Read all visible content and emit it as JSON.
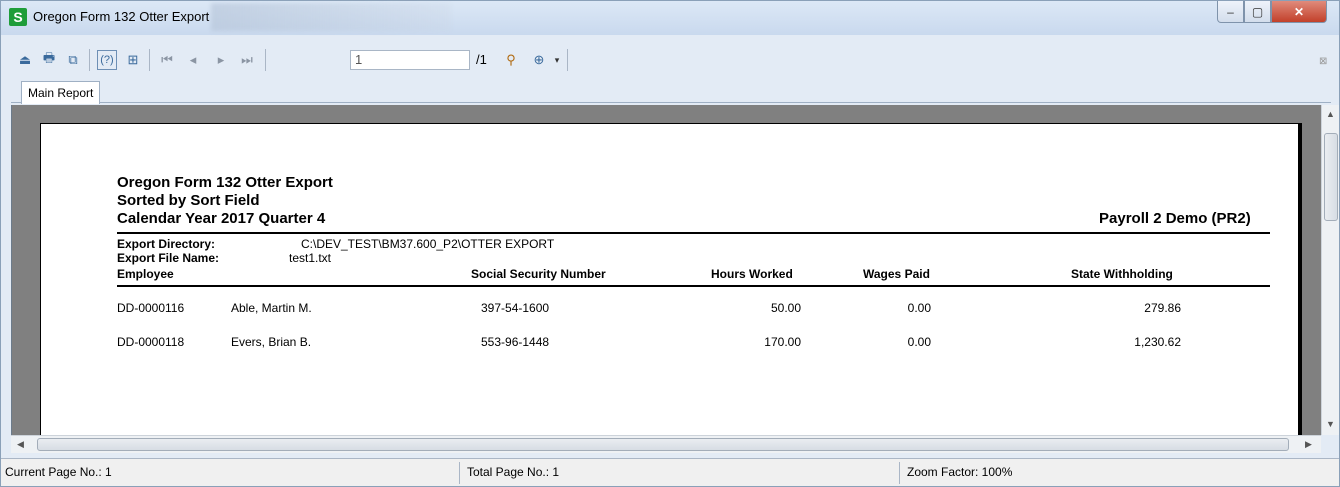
{
  "window": {
    "title": "Oregon Form 132 Otter Export",
    "icon_letter": "S",
    "minimize": "–",
    "maximize": "▢",
    "close": "✕"
  },
  "toolbar": {
    "page_input_value": "1",
    "page_total": "/1"
  },
  "tabs": [
    {
      "label": "Main Report"
    }
  ],
  "report": {
    "title_line1": "Oregon Form 132 Otter Export",
    "title_line2": "Sorted by Sort Field",
    "title_line3": "Calendar Year 2017 Quarter 4",
    "company": "Payroll 2 Demo (PR2)",
    "export_directory_label": "Export Directory:",
    "export_directory_value": "C:\\DEV_TEST\\BM37.600_P2\\OTTER EXPORT",
    "export_file_label": "Export File Name:",
    "export_file_value": "test1.txt",
    "columns": {
      "employee": "Employee",
      "ssn": "Social Security Number",
      "hours": "Hours Worked",
      "wages": "Wages Paid",
      "withholding": "State Withholding"
    },
    "rows": [
      {
        "id": "DD-0000116",
        "name": "Able, Martin M.",
        "ssn": "397-54-1600",
        "hours": "50.00",
        "wages": "0.00",
        "withholding": "279.86"
      },
      {
        "id": "DD-0000118",
        "name": "Evers, Brian B.",
        "ssn": "553-96-1448",
        "hours": "170.00",
        "wages": "0.00",
        "withholding": "1,230.62"
      }
    ]
  },
  "status": {
    "current_page": "Current Page No.: 1",
    "total_page": "Total Page No.: 1",
    "zoom": "Zoom Factor: 100%"
  }
}
